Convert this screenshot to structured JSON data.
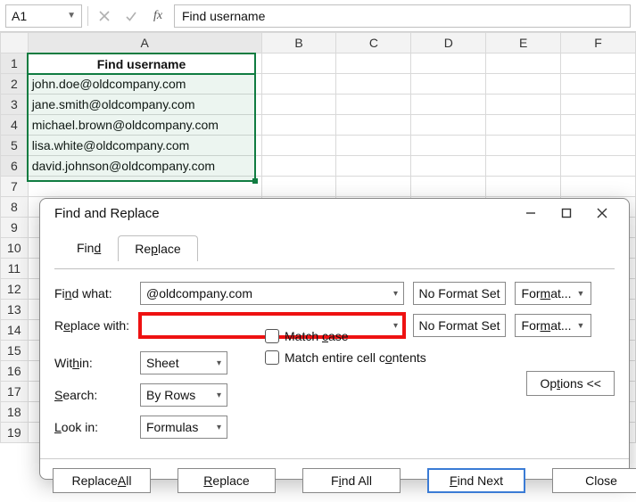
{
  "formula_bar": {
    "name_box": "A1",
    "value": "Find username"
  },
  "columns": [
    "A",
    "B",
    "C",
    "D",
    "E",
    "F"
  ],
  "rows": {
    "visible_count": 19,
    "selected_row_headers": [
      1,
      2,
      3,
      4,
      5,
      6
    ],
    "data": [
      {
        "A": "Find username"
      },
      {
        "A": "john.doe@oldcompany.com"
      },
      {
        "A": "jane.smith@oldcompany.com"
      },
      {
        "A": "michael.brown@oldcompany.com"
      },
      {
        "A": "lisa.white@oldcompany.com"
      },
      {
        "A": "david.johnson@oldcompany.com"
      }
    ]
  },
  "dialog": {
    "title": "Find and Replace",
    "tabs": {
      "find": "Find",
      "replace": "Replace",
      "active": "replace"
    },
    "find_what_label": "Find what:",
    "find_what_value": "@oldcompany.com",
    "replace_with_label": "Replace with:",
    "replace_with_value": "",
    "no_format": "No Format Set",
    "format_btn": "Format...",
    "within_label": "Within:",
    "within_value": "Sheet",
    "search_label": "Search:",
    "search_value": "By Rows",
    "lookin_label": "Look in:",
    "lookin_value": "Formulas",
    "match_case": "Match case",
    "match_entire": "Match entire cell contents",
    "options_btn": "Options <<",
    "buttons": {
      "replace_all": "Replace All",
      "replace": "Replace",
      "find_all": "Find All",
      "find_next": "Find Next",
      "close": "Close"
    }
  }
}
